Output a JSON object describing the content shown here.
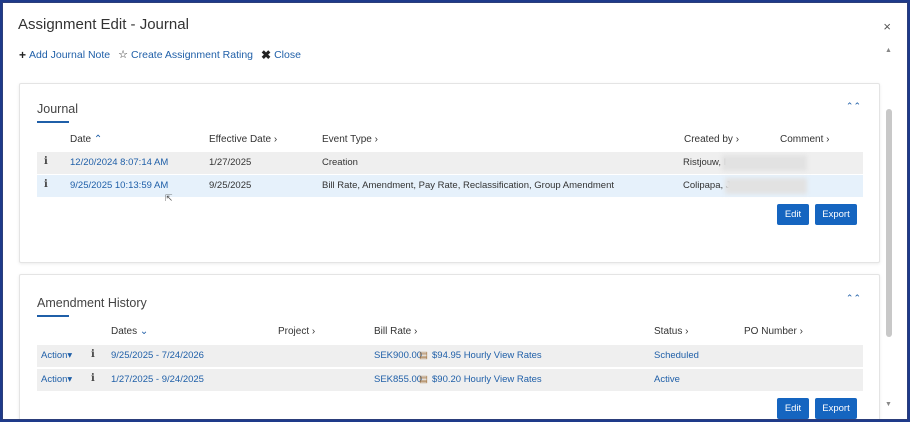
{
  "window": {
    "title": "Assignment Edit - Journal",
    "close_glyph": "×"
  },
  "toolbar": {
    "add_note": "Add Journal Note",
    "create_rating": "Create Assignment Rating",
    "close": "Close"
  },
  "journal": {
    "title": "Journal",
    "headers": {
      "date": "Date",
      "effective_date": "Effective Date",
      "event_type": "Event Type",
      "created_by": "Created by",
      "comment": "Comment"
    },
    "rows": [
      {
        "date": "12/20/2024 8:07:14 AM",
        "effective_date": "1/27/2025",
        "event_type": "Creation",
        "created_by": "Ristjouw, I"
      },
      {
        "date": "9/25/2025 10:13:59 AM",
        "effective_date": "9/25/2025",
        "event_type": "Bill Rate, Amendment, Pay Rate, Reclassification, Group Amendment",
        "created_by": "Colipapa, J"
      }
    ],
    "edit": "Edit",
    "export": "Export"
  },
  "amendment": {
    "title": "Amendment History",
    "headers": {
      "dates": "Dates",
      "project": "Project",
      "bill_rate": "Bill Rate",
      "status": "Status",
      "po_number": "PO Number"
    },
    "action_label": "Action",
    "rows": [
      {
        "dates": "9/25/2025 - 7/24/2026",
        "bill_rate": "SEK900.00",
        "hourly": "$94.95 Hourly View Rates",
        "status": "Scheduled"
      },
      {
        "dates": "1/27/2025 - 9/24/2025",
        "bill_rate": "SEK855.00",
        "hourly": "$90.20 Hourly View Rates",
        "status": "Active"
      }
    ],
    "edit": "Edit",
    "export": "Export"
  },
  "colors": {
    "accent": "#1565c0",
    "link": "#1f5fa8",
    "row_grey": "#efefef",
    "row_blue": "#e6f1fb"
  }
}
